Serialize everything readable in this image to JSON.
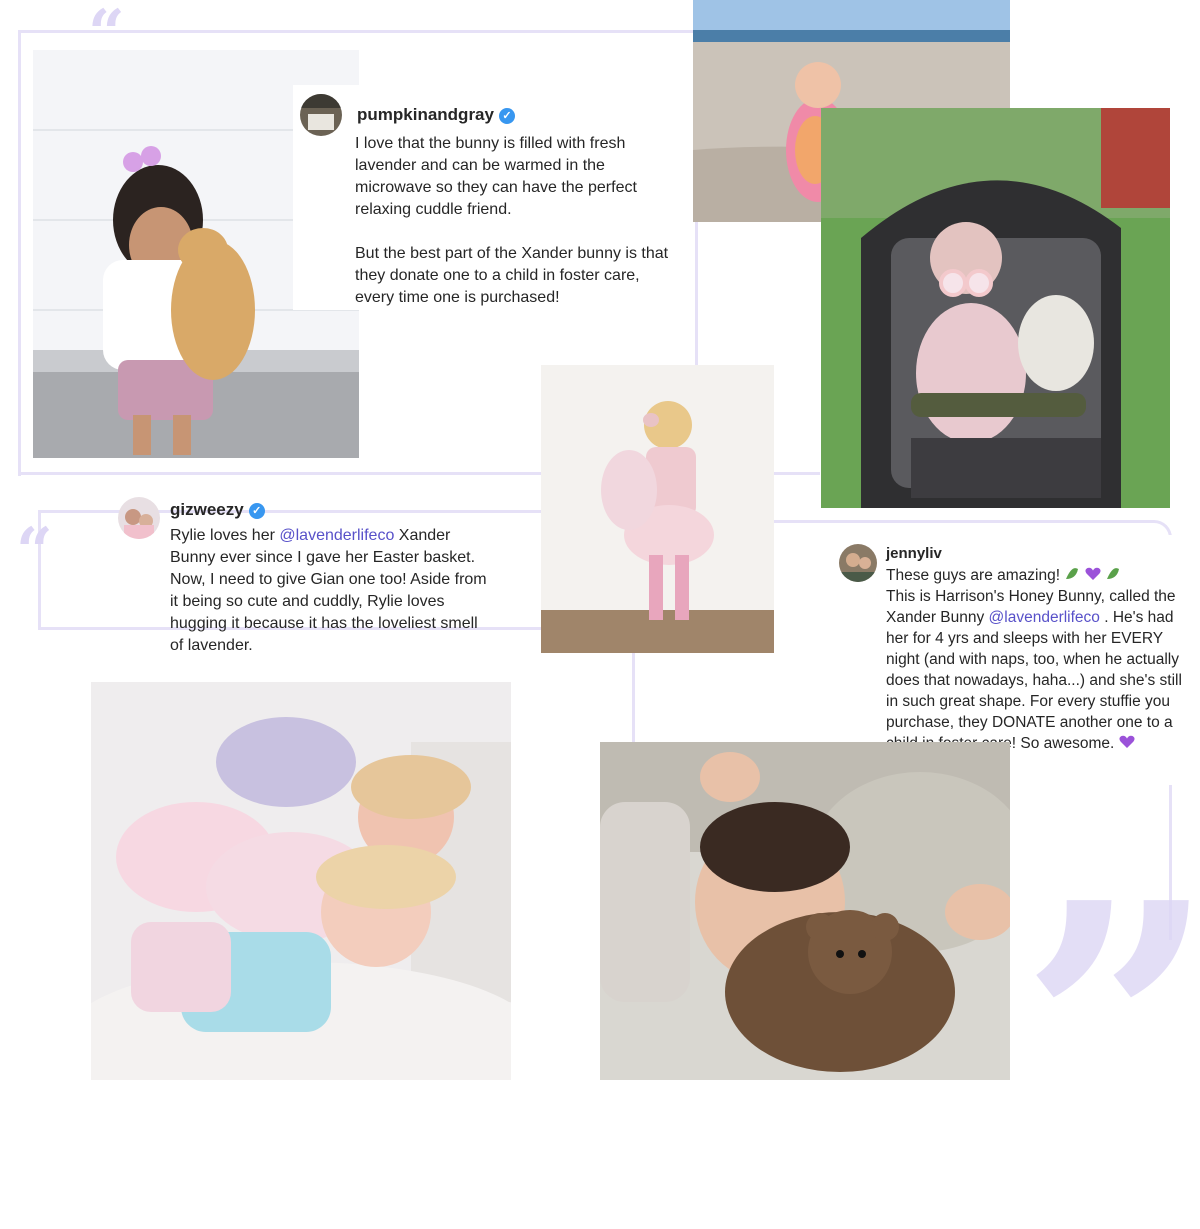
{
  "decor": {
    "open_quote": "“",
    "close_quote": "”",
    "accent_color": "#ddd6f5"
  },
  "reviews": [
    {
      "handle": "pumpkinandgray",
      "verified": true,
      "paragraph1": "I love that the bunny is filled with fresh lavender and can be warmed in the microwave so they can have the perfect relaxing cuddle friend.",
      "paragraph2": "But the best part of the Xander bunny is that they donate one to a child in foster care, every time one is purchased!"
    },
    {
      "handle": "gizweezy",
      "verified": true,
      "text_before": "Rylie loves her ",
      "mention": "@lavenderlifeco",
      "text_after": " Xander Bunny ever since I gave her Easter basket. Now, I need to give Gian one too! Aside from it being so cute and cuddly, Rylie loves hugging it because it has the loveliest smell of lavender."
    },
    {
      "handle": "jennyliv",
      "verified": false,
      "line1": "These guys are amazing!",
      "text_before": "This is Harrison's Honey Bunny, called the Xander Bunny ",
      "mention": "@lavenderlifeco",
      "text_after": " . He's had her for 4 yrs and sleeps with her EVERY night (and with naps, too, when he actually does that nowadays, haha...) and she's still in such great shape.  For every stuffie you purchase, they DONATE another one to a child in foster care!  So awesome."
    }
  ],
  "icons": {
    "verified": "verified-badge-icon",
    "heart": "purple-heart-icon",
    "leaf": "herb-leaf-icon"
  }
}
